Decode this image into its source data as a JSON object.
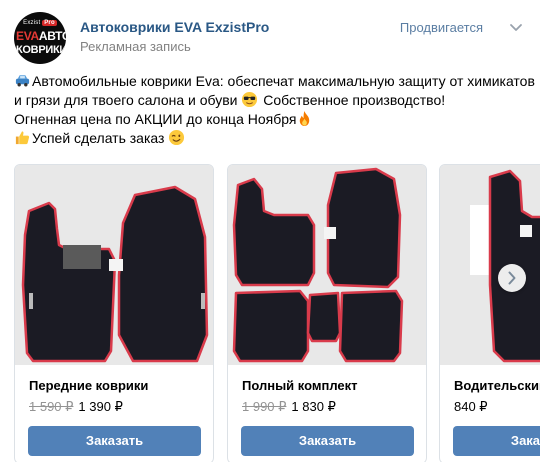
{
  "post": {
    "author": "Автоковрики EVA ExzistPro",
    "subtitle": "Рекламная запись",
    "sponsored_label": "Продвигается",
    "avatar": {
      "top_text": "Exzist",
      "top_badge": "Pro",
      "line1_a": "EVA",
      "line1_b": "АВТО",
      "line2": "КОВРИКИ"
    },
    "text": {
      "line1": "Автомобильные коврики Eva: обеспечат максимальную защиту от химикатов",
      "line2": "и грязи для твоего салона и обуви",
      "line2_b": "Собственное производство!",
      "line3": "Огненная цена по АКЦИИ до конца Ноября",
      "line4": "Успей сделать заказ"
    },
    "icons": [
      "car-emoji-icon",
      "sunglasses-emoji-icon",
      "fire-emoji-icon",
      "thumbs-up-emoji-icon",
      "wink-emoji-icon",
      "chevron-down-icon",
      "chevron-right-icon"
    ]
  },
  "products": [
    {
      "title": "Передние коврики",
      "old_price": "1 590 ₽",
      "price": "1 390 ₽",
      "button": "Заказать"
    },
    {
      "title": "Полный комплект",
      "old_price": "1 990 ₽",
      "price": "1 830 ₽",
      "button": "Заказать"
    },
    {
      "title": "Водительский",
      "old_price": "",
      "price": "840 ₽",
      "button": "Заказать"
    }
  ],
  "colors": {
    "link": "#2a5885",
    "button": "#5181b8",
    "mat": "#1b1b24",
    "mat_edge": "#d93b4b"
  }
}
